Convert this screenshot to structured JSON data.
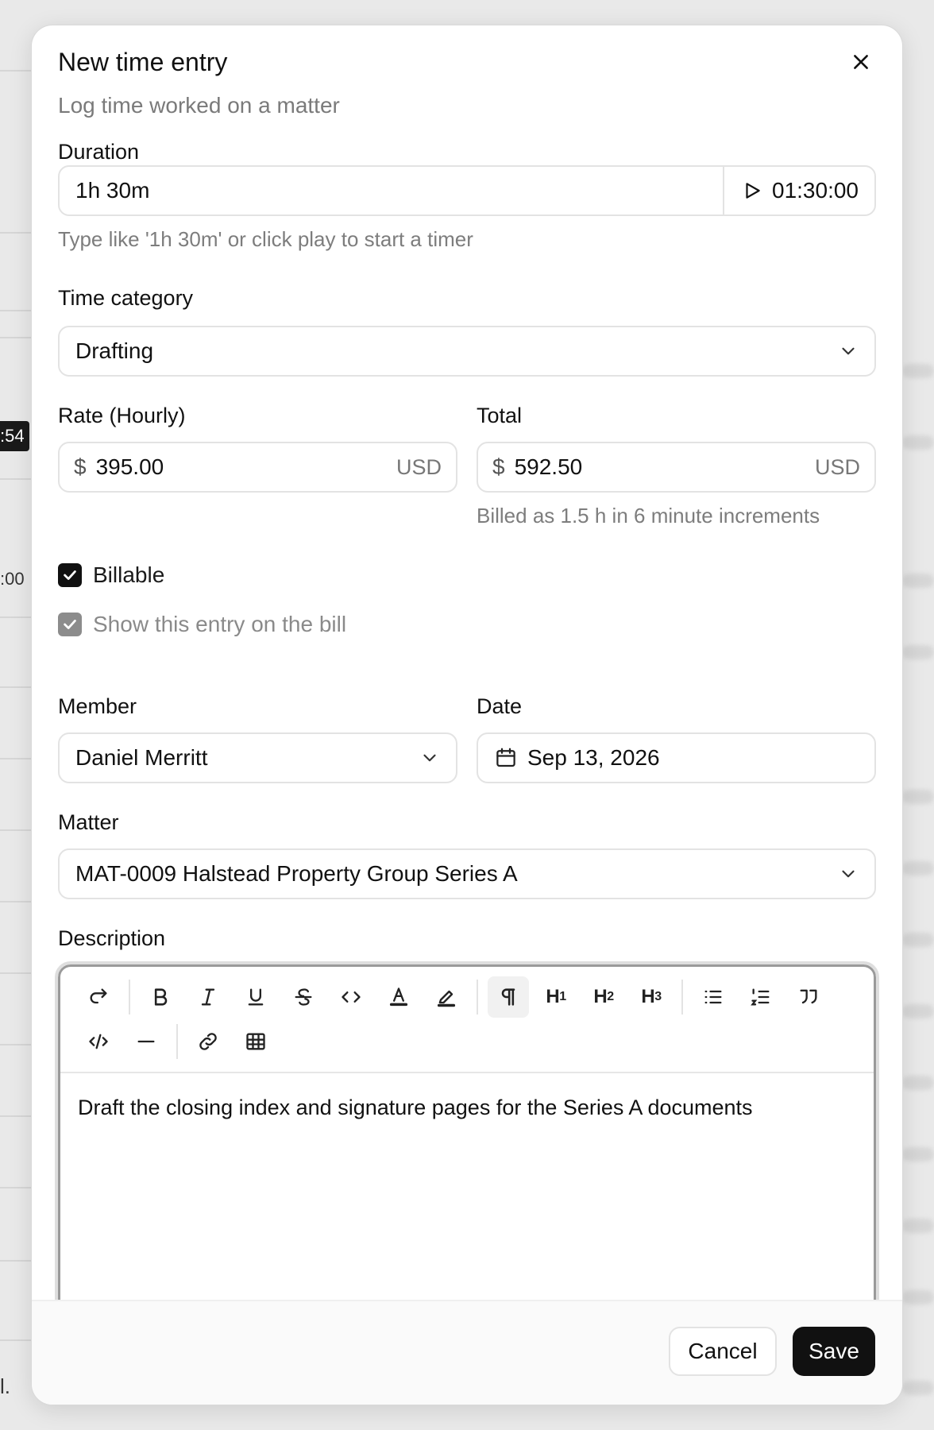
{
  "background": {
    "chip_text": ":54",
    "time_text": ":00",
    "footer_text": "l."
  },
  "modal": {
    "title": "New time entry",
    "subtitle": "Log time worked on a matter",
    "close_icon": "close-icon"
  },
  "duration": {
    "label": "Duration",
    "value": "1h 30m",
    "timer": "01:30:00",
    "hint": "Type like '1h 30m' or click play to start a timer"
  },
  "category": {
    "label": "Time category",
    "value": "Drafting"
  },
  "rate": {
    "label": "Rate (Hourly)",
    "symbol": "$",
    "value": "395.00",
    "unit": "USD"
  },
  "total": {
    "label": "Total",
    "symbol": "$",
    "value": "592.50",
    "unit": "USD",
    "hint": "Billed as 1.5 h in 6 minute increments"
  },
  "billable": {
    "label": "Billable",
    "checked": true
  },
  "show_on_bill": {
    "label": "Show this entry on the bill",
    "checked": true
  },
  "member": {
    "label": "Member",
    "value": "Daniel Merritt"
  },
  "date": {
    "label": "Date",
    "value": "Sep 13, 2026"
  },
  "matter": {
    "label": "Matter",
    "value": "MAT-0009 Halstead Property Group Series A"
  },
  "description": {
    "label": "Description",
    "text": "Draft the closing index and signature pages for the Series A documents",
    "toolbar": {
      "h1": "H",
      "h1_sub": "1",
      "h2": "H",
      "h2_sub": "2",
      "h3": "H",
      "h3_sub": "3"
    }
  },
  "footer": {
    "cancel": "Cancel",
    "save": "Save"
  },
  "colors": {
    "primary": "#111111",
    "border": "#e3e3e3",
    "muted_text": "#7a7a7a"
  }
}
